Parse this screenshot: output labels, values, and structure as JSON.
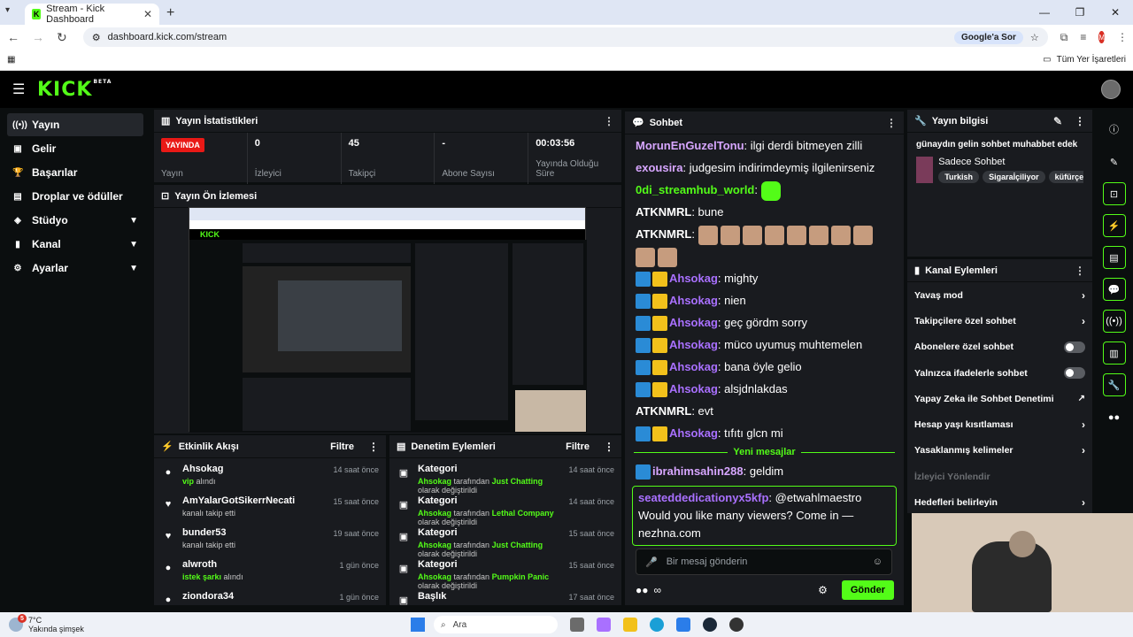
{
  "browser": {
    "tab_title": "Stream - Kick Dashboard",
    "url": "dashboard.kick.com/stream",
    "google_button": "Google'a Sor",
    "profile_initial": "M",
    "bookmarks_label": "Tüm Yer İşaretleri"
  },
  "header": {
    "logo": "KICK",
    "logo_sup": "BETA"
  },
  "sidebar": {
    "items": [
      {
        "label": "Yayın",
        "icon": "((•))"
      },
      {
        "label": "Gelir",
        "icon": "▣"
      },
      {
        "label": "Başarılar",
        "icon": "🏆"
      },
      {
        "label": "Droplar ve ödüller",
        "icon": "▤"
      },
      {
        "label": "Stüdyo",
        "icon": "◈"
      },
      {
        "label": "Kanal",
        "icon": "▮"
      },
      {
        "label": "Ayarlar",
        "icon": "⚙"
      }
    ]
  },
  "stats": {
    "title": "Yayın İstatistikleri",
    "live_badge": "YAYINDA",
    "live_label": "Yayın",
    "viewers_value": "0",
    "viewers_label": "İzleyici",
    "followers_value": "45",
    "followers_label": "Takipçi",
    "subs_value": "-",
    "subs_label": "Abone Sayısı",
    "uptime_value": "00:03:56",
    "uptime_label": "Yayında Olduğu Süre"
  },
  "preview": {
    "title": "Yayın Ön İzlemesi",
    "mini_logo": "KICK"
  },
  "activity": {
    "title": "Etkinlik Akışı",
    "filter": "Filtre",
    "rows": [
      {
        "name": "Ahsokag",
        "green": "vip",
        "rest": " alındı",
        "time": "14 saat önce"
      },
      {
        "name": "AmYalarGotSikerrNecati",
        "green": "",
        "rest": "kanalı takip etti",
        "time": "15 saat önce"
      },
      {
        "name": "bunder53",
        "green": "",
        "rest": "kanalı takip etti",
        "time": "19 saat önce"
      },
      {
        "name": "alwroth",
        "green": "istek şarkı",
        "rest": " alındı",
        "time": "1 gün önce"
      },
      {
        "name": "ziondora34",
        "green": "",
        "rest": "",
        "time": "1 gün önce"
      }
    ]
  },
  "moderation": {
    "title": "Denetim Eylemleri",
    "filter": "Filtre",
    "rows": [
      {
        "name": "Kategori",
        "by": "Ahsokag",
        "mid": " tarafından ",
        "game": "Just Chatting",
        "end": " olarak değiştirildi",
        "time": "14 saat önce"
      },
      {
        "name": "Kategori",
        "by": "Ahsokag",
        "mid": " tarafından ",
        "game": "Lethal Company",
        "end": " olarak değiştirildi",
        "time": "14 saat önce"
      },
      {
        "name": "Kategori",
        "by": "Ahsokag",
        "mid": " tarafından ",
        "game": "Just Chatting",
        "end": " olarak değiştirildi",
        "time": "15 saat önce"
      },
      {
        "name": "Kategori",
        "by": "Ahsokag",
        "mid": " tarafından ",
        "game": "Pumpkin Panic",
        "end": " olarak değiştirildi",
        "time": "15 saat önce"
      },
      {
        "name": "Başlık",
        "by": "",
        "mid": "",
        "game": "",
        "end": "",
        "time": "17 saat önce"
      }
    ]
  },
  "chat": {
    "title": "Sohbet",
    "messages": [
      {
        "user": "MorunEnGuzelTonu",
        "color": "#d7a6ff",
        "text": "ilgi derdi bitmeyen zilli",
        "badges": 0
      },
      {
        "user": "exousira",
        "color": "#d7a6ff",
        "text": "judgesim indirimdeymiş ilgilenirseniz",
        "badges": 0
      },
      {
        "user": "0di_streamhub_world",
        "color": "#53fc18",
        "text": "",
        "badges": 0
      },
      {
        "user": "ATKNMRL",
        "color": "#ffffff",
        "text": "bune",
        "badges": 0
      },
      {
        "user": "ATKNMRL",
        "color": "#ffffff",
        "text": "",
        "badges": 0
      },
      {
        "user": "Ahsokag",
        "color": "#a970ff",
        "text": "mighty",
        "badges": 2
      },
      {
        "user": "Ahsokag",
        "color": "#a970ff",
        "text": "nien",
        "badges": 2
      },
      {
        "user": "Ahsokag",
        "color": "#a970ff",
        "text": "geç gördm sorry",
        "badges": 2
      },
      {
        "user": "Ahsokag",
        "color": "#a970ff",
        "text": "müco uyumuş muhtemelen",
        "badges": 2
      },
      {
        "user": "Ahsokag",
        "color": "#a970ff",
        "text": "bana öyle gelio",
        "badges": 2
      },
      {
        "user": "Ahsokag",
        "color": "#a970ff",
        "text": "alsjdnlakdas",
        "badges": 2
      },
      {
        "user": "ATKNMRL",
        "color": "#ffffff",
        "text": "evt",
        "badges": 0
      },
      {
        "user": "Ahsokag",
        "color": "#a970ff",
        "text": "tıfıtı glcn mi",
        "badges": 2
      }
    ],
    "new_messages": "Yeni mesajlar",
    "after_new": {
      "user": "ibrahimsahin288",
      "color": "#d7a6ff",
      "text": "geldim"
    },
    "pinned": {
      "user": "seateddedicationyx5kfp",
      "text": "@etwahlmaestro Would you like many viewers? Come in — nezhna.com"
    },
    "input_placeholder": "Bir mesaj gönderin",
    "send": "Gönder"
  },
  "stream_info": {
    "title": "Yayın bilgisi",
    "stream_title": "günaydın gelin sohbet muhabbet edek",
    "category": "Sadece Sohbet",
    "tags": [
      "Turkish",
      "Sigaraİçiliyor",
      "küfürçerebi"
    ]
  },
  "channel_actions": {
    "title": "Kanal Eylemleri",
    "items": [
      {
        "label": "Yavaş mod",
        "kind": "arrow"
      },
      {
        "label": "Takipçilere özel sohbet",
        "kind": "arrow"
      },
      {
        "label": "Abonelere özel sohbet",
        "kind": "toggle"
      },
      {
        "label": "Yalnızca ifadelerle sohbet",
        "kind": "toggle"
      },
      {
        "label": "Yapay Zeka ile Sohbet Denetimi",
        "kind": "ext"
      },
      {
        "label": "Hesap yaşı kısıtlaması",
        "kind": "arrow"
      },
      {
        "label": "Yasaklanmış kelimeler",
        "kind": "arrow"
      },
      {
        "label": "İzleyici Yönlendir",
        "kind": "dim"
      },
      {
        "label": "Hedefleri belirleyin",
        "kind": "arrow"
      }
    ]
  },
  "taskbar": {
    "temp": "7°C",
    "weather": "Yakında şimşek",
    "badge": "5",
    "search": "Ara"
  }
}
